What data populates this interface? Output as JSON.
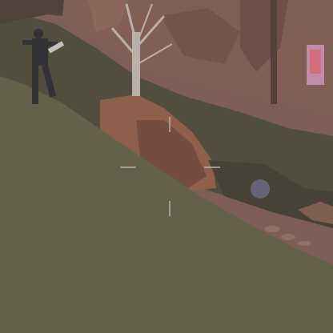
{
  "game": {
    "view": "third-person",
    "environment": "canyon-hillside",
    "hud": {
      "crosshair": {
        "style": "four-tick",
        "color": "#b9b3ad"
      }
    },
    "colors": {
      "sky": "#8a6a60",
      "rock_wall": "#7e5a50",
      "rock_shadow": "#5f443d",
      "grass_near": "#5e5c45",
      "grass_far": "#4d4a38",
      "boulder": "#8b5a48",
      "tree_trunk": "#b9b0a8",
      "character_dark": "#2a2a30",
      "character_accent": "#c8c0b8",
      "pickup_glow": "#7a7ab0"
    },
    "icons": {
      "pickup": "floating-card-icon",
      "orb": "glowing-orb-icon"
    }
  }
}
